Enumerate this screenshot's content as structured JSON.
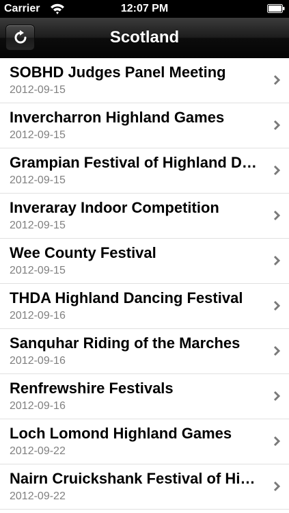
{
  "status_bar": {
    "carrier": "Carrier",
    "time": "12:07 PM",
    "wifi_icon": "wifi-icon",
    "battery_icon": "battery-icon"
  },
  "nav_bar": {
    "title": "Scotland",
    "refresh_icon": "refresh-icon",
    "colors": {
      "bar": "#1c1c1c",
      "title": "#ffffff"
    }
  },
  "events": [
    {
      "title": "SOBHD Judges Panel Meeting",
      "date": "2012-09-15"
    },
    {
      "title": "Invercharron Highland Games",
      "date": "2012-09-15"
    },
    {
      "title": "Grampian Festival of Highland Dancing",
      "date": "2012-09-15"
    },
    {
      "title": "Inveraray Indoor Competition",
      "date": "2012-09-15"
    },
    {
      "title": "Wee County Festival",
      "date": "2012-09-15"
    },
    {
      "title": "THDA Highland Dancing Festival",
      "date": "2012-09-16"
    },
    {
      "title": "Sanquhar Riding of the Marches",
      "date": "2012-09-16"
    },
    {
      "title": "Renfrewshire Festivals",
      "date": "2012-09-16"
    },
    {
      "title": "Loch Lomond Highland Games",
      "date": "2012-09-22"
    },
    {
      "title": "Nairn Cruickshank Festival of Highland Dancing",
      "date": "2012-09-22"
    }
  ],
  "list_icons": {
    "row_accessory": "chevron-right-icon"
  },
  "colors": {
    "date_text": "#808080",
    "separator": "#e0e0e0",
    "chevron": "#7a7a7a"
  }
}
